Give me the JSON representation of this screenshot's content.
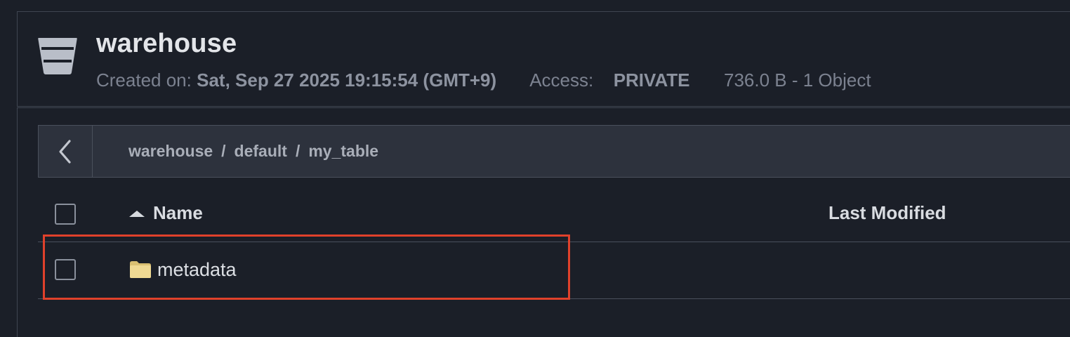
{
  "bucket": {
    "name": "warehouse",
    "created_label": "Created on:",
    "created_value": "Sat, Sep 27 2025 19:15:54 (GMT+9)",
    "access_label": "Access:",
    "access_value": "PRIVATE",
    "size_summary": "736.0 B - 1 Object",
    "icon": "bucket-icon"
  },
  "navigation": {
    "back_icon": "chevron-left-icon",
    "breadcrumb": [
      "warehouse",
      "default",
      "my_table"
    ],
    "separator": "/"
  },
  "table": {
    "columns": {
      "name": "Name",
      "last_modified": "Last Modified"
    },
    "sort_icon": "sort-ascending-icon",
    "rows": [
      {
        "name": "metadata",
        "type": "folder",
        "icon": "folder-icon",
        "last_modified": ""
      }
    ]
  },
  "colors": {
    "background": "#1b1f28",
    "breadcrumb_bar": "#2d323d",
    "folder": "#e8d28f",
    "highlight": "#e0412b"
  }
}
